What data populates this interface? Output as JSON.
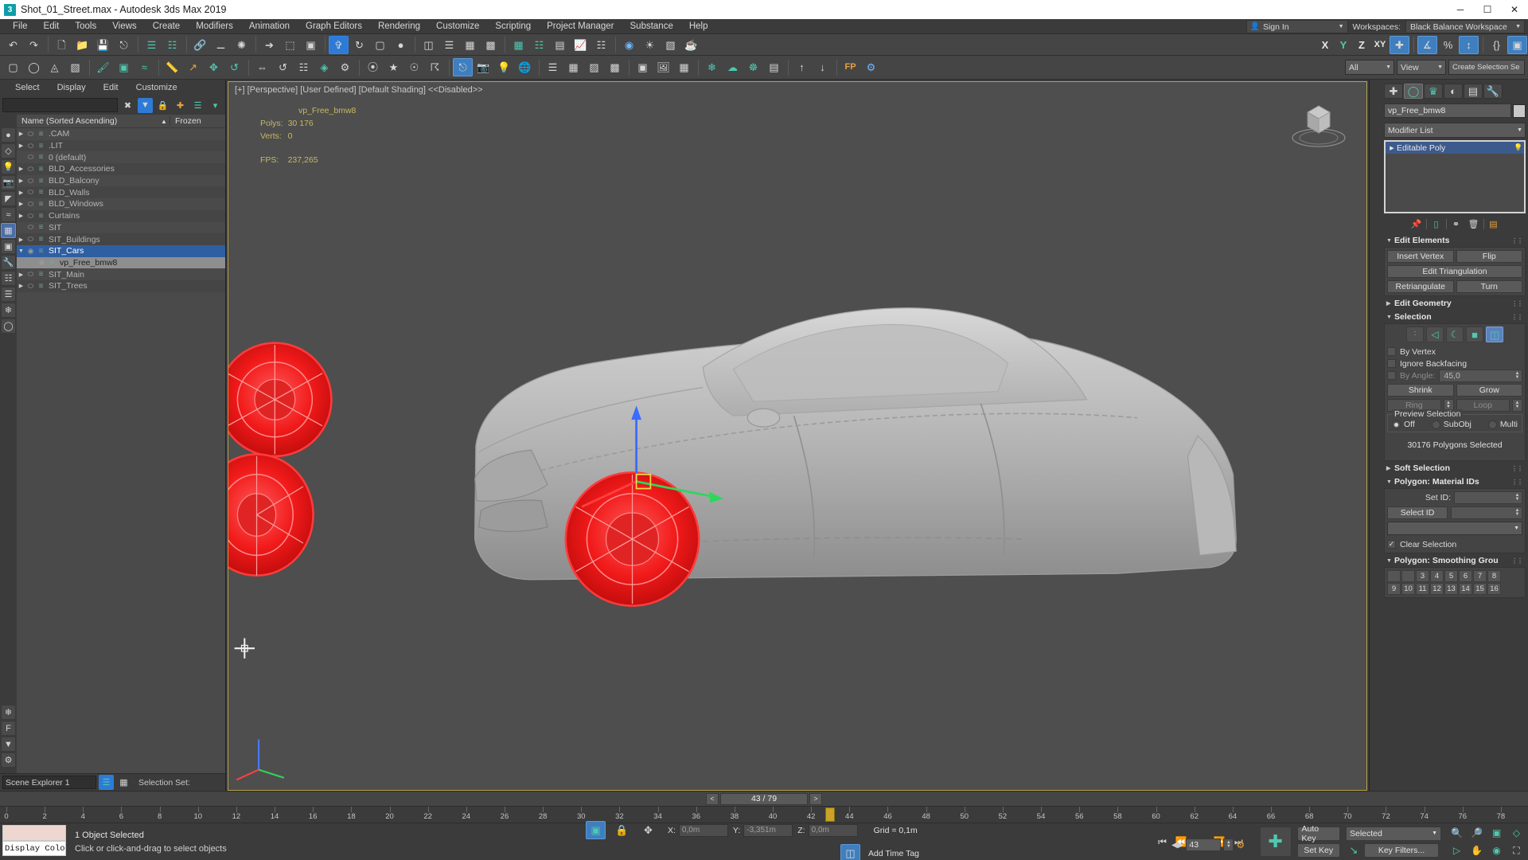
{
  "window": {
    "title": "Shot_01_Street.max - Autodesk 3ds Max 2019",
    "app_badge": "3",
    "minimize": "─",
    "maximize": "☐",
    "close": "✕"
  },
  "menubar": {
    "items": [
      "File",
      "Edit",
      "Tools",
      "Views",
      "Create",
      "Modifiers",
      "Animation",
      "Graph Editors",
      "Rendering",
      "Customize",
      "Scripting",
      "Project Manager",
      "Substance",
      "Help"
    ]
  },
  "account": {
    "sign_in": "Sign In",
    "workspaces_label": "Workspaces:",
    "workspace": "Black Balance Workspace"
  },
  "toolbar2": {
    "selection_filter": "All",
    "reference_coordinate": "View",
    "named_selection_sets": "Create Selection Se",
    "axis_x": "X",
    "axis_y": "Y",
    "axis_z": "Z",
    "axis_xy": "XY"
  },
  "scene_explorer": {
    "menu": [
      "Select",
      "Display",
      "Edit",
      "Customize"
    ],
    "find_placeholder": "",
    "find_value": "",
    "columns": {
      "name": "Name (Sorted Ascending)",
      "sort_arrow": "▲",
      "frozen": "Frozen"
    },
    "footer": {
      "explorer_name": "Scene Explorer 1",
      "selection_set_label": "Selection Set:"
    },
    "items": [
      {
        "name": ".CAM",
        "indent": 0,
        "expandable": true,
        "expanded": false,
        "visible": false,
        "selected": false,
        "group": false
      },
      {
        "name": ".LIT",
        "indent": 0,
        "expandable": true,
        "expanded": false,
        "visible": false,
        "selected": false,
        "group": false
      },
      {
        "name": "0 (default)",
        "indent": 0,
        "expandable": false,
        "expanded": false,
        "visible": false,
        "selected": false,
        "group": false
      },
      {
        "name": "BLD_Accessories",
        "indent": 0,
        "expandable": true,
        "expanded": false,
        "visible": false,
        "selected": false,
        "group": false
      },
      {
        "name": "BLD_Balcony",
        "indent": 0,
        "expandable": true,
        "expanded": false,
        "visible": false,
        "selected": false,
        "group": false
      },
      {
        "name": "BLD_Walls",
        "indent": 0,
        "expandable": true,
        "expanded": false,
        "visible": false,
        "selected": false,
        "group": false
      },
      {
        "name": "BLD_Windows",
        "indent": 0,
        "expandable": true,
        "expanded": false,
        "visible": false,
        "selected": false,
        "group": false
      },
      {
        "name": "Curtains",
        "indent": 0,
        "expandable": true,
        "expanded": false,
        "visible": false,
        "selected": false,
        "group": false
      },
      {
        "name": "SIT",
        "indent": 0,
        "expandable": false,
        "expanded": false,
        "visible": false,
        "selected": false,
        "group": false
      },
      {
        "name": "SIT_Buildings",
        "indent": 0,
        "expandable": true,
        "expanded": false,
        "visible": false,
        "selected": false,
        "group": false
      },
      {
        "name": "SIT_Cars",
        "indent": 0,
        "expandable": true,
        "expanded": true,
        "visible": true,
        "selected": true,
        "group": true
      },
      {
        "name": "vp_Free_bmw8",
        "indent": 1,
        "expandable": false,
        "expanded": false,
        "visible": true,
        "selected": false,
        "group": false,
        "name_highlight": true
      },
      {
        "name": "SIT_Main",
        "indent": 0,
        "expandable": true,
        "expanded": false,
        "visible": false,
        "selected": false,
        "group": false
      },
      {
        "name": "SIT_Trees",
        "indent": 0,
        "expandable": true,
        "expanded": false,
        "visible": false,
        "selected": false,
        "group": false
      }
    ]
  },
  "viewport": {
    "label": "[+] [Perspective] [User Defined] [Default Shading]  <<Disabled>>",
    "stats": {
      "object_name": "vp_Free_bmw8",
      "polys_label": "Polys:",
      "polys_value": "30 176",
      "verts_label": "Verts:",
      "verts_value": "0",
      "fps_label": "FPS:",
      "fps_value": "237,265"
    }
  },
  "command_panel": {
    "tabs": [
      "create-tab",
      "modify-tab",
      "hierarchy-tab",
      "motion-tab",
      "display-tab",
      "utilities-tab"
    ],
    "object_name": "vp_Free_bmw8",
    "modifier_list": "Modifier List",
    "stack": [
      {
        "label": "Editable Poly",
        "selected": true
      }
    ],
    "rollouts": {
      "edit_elements": {
        "title": "Edit Elements",
        "insert_vertex": "Insert Vertex",
        "flip": "Flip",
        "edit_triangulation": "Edit Triangulation",
        "retriangulate": "Retriangulate",
        "turn": "Turn"
      },
      "edit_geometry": {
        "title": "Edit Geometry",
        "expanded": false
      },
      "selection": {
        "title": "Selection",
        "sub_object_modes": [
          "vertex-icon",
          "edge-icon",
          "border-icon",
          "polygon-icon",
          "element-icon"
        ],
        "active_mode_index": 4,
        "by_vertex": "By Vertex",
        "ignore_backfacing": "Ignore Backfacing",
        "by_angle": "By Angle:",
        "by_angle_value": "45,0",
        "shrink": "Shrink",
        "grow": "Grow",
        "ring": "Ring",
        "loop": "Loop",
        "preview_selection": "Preview Selection",
        "preview_options": [
          "Off",
          "SubObj",
          "Multi"
        ],
        "preview_selected_index": 0,
        "status": "30176 Polygons Selected"
      },
      "soft_selection": {
        "title": "Soft Selection",
        "expanded": false
      },
      "material_ids": {
        "title": "Polygon: Material IDs",
        "set_id": "Set ID:",
        "set_id_value": "",
        "select_id": "Select ID",
        "select_id_value": "",
        "id_dropdown_value": "",
        "clear_selection": "Clear Selection",
        "clear_selection_checked": true
      },
      "smoothing_groups": {
        "title": "Polygon: Smoothing Grou",
        "row1": [
          "",
          "",
          "3",
          "4",
          "5",
          "6",
          "7",
          "8"
        ],
        "row2": [
          "9",
          "10",
          "11",
          "12",
          "13",
          "14",
          "15",
          "16"
        ]
      }
    }
  },
  "timeline": {
    "prev": "<",
    "next": ">",
    "frame_display": "43 / 79",
    "current_frame": 43,
    "total_frames": 79,
    "ruler_ticks": [
      0,
      2,
      4,
      6,
      8,
      10,
      12,
      14,
      16,
      18,
      20,
      22,
      24,
      26,
      28,
      30,
      32,
      34,
      36,
      38,
      40,
      42,
      44,
      46,
      48,
      50,
      52,
      54,
      56,
      58,
      60,
      62,
      64,
      66,
      68,
      70,
      72,
      74,
      76,
      78
    ]
  },
  "statusbar": {
    "display_color_label": "Display Colo",
    "display_color_swatch": "#eed7d0",
    "selection_status": "1 Object Selected",
    "prompt": "Click or click-and-drag to select objects",
    "coords": {
      "x_label": "X:",
      "x_value": "0,0m",
      "y_label": "Y:",
      "y_value": "-3,351m",
      "z_label": "Z:",
      "z_value": "0,0m",
      "grid": "Grid = 0,1m"
    },
    "add_time_tag": "Add Time Tag",
    "auto_key": "Auto Key",
    "set_key": "Set Key",
    "key_mode": "Selected",
    "key_filters": "Key Filters...",
    "frame_field": "43"
  },
  "colors": {
    "accent_blue": "#2d7bd6",
    "selection_red": "#ff2020",
    "teal": "#4ec9b0",
    "viewport_bg": "#4e4e4e",
    "panel_bg": "#3b3b3b",
    "stat_yellow": "#c7b861",
    "viewport_border": "#b8a24a"
  }
}
